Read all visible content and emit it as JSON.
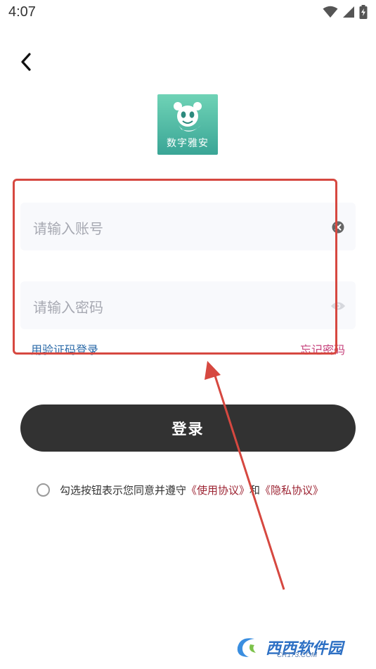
{
  "status_bar": {
    "time": "4:07",
    "icons": [
      "wifi-icon",
      "signal-icon",
      "battery-charging-icon"
    ]
  },
  "header": {
    "back_icon": "chevron-left-icon"
  },
  "logo": {
    "icon": "panda-icon",
    "text": "数字雅安",
    "colors": [
      "#6fd3b6",
      "#3aa596"
    ]
  },
  "form": {
    "account": {
      "placeholder": "请输入账号",
      "icon": "clear-icon"
    },
    "password": {
      "placeholder": "请输入密码",
      "icon": "eye-icon"
    },
    "sms_login_link": "用验证码登录",
    "forgot_password_link": "忘记密码"
  },
  "login_button": {
    "label": "登录",
    "color": "#323232"
  },
  "agreement": {
    "prefix": "勾选按钮表示您同意并遵守",
    "terms_link": "《使用协议》",
    "conjunction": "和",
    "privacy_link": "《隐私协议》",
    "link_color": "#9c2332"
  },
  "annotation": {
    "box_color": "#d64840"
  },
  "watermark": {
    "text": "西西软件园",
    "sub": "CR173.COM"
  }
}
